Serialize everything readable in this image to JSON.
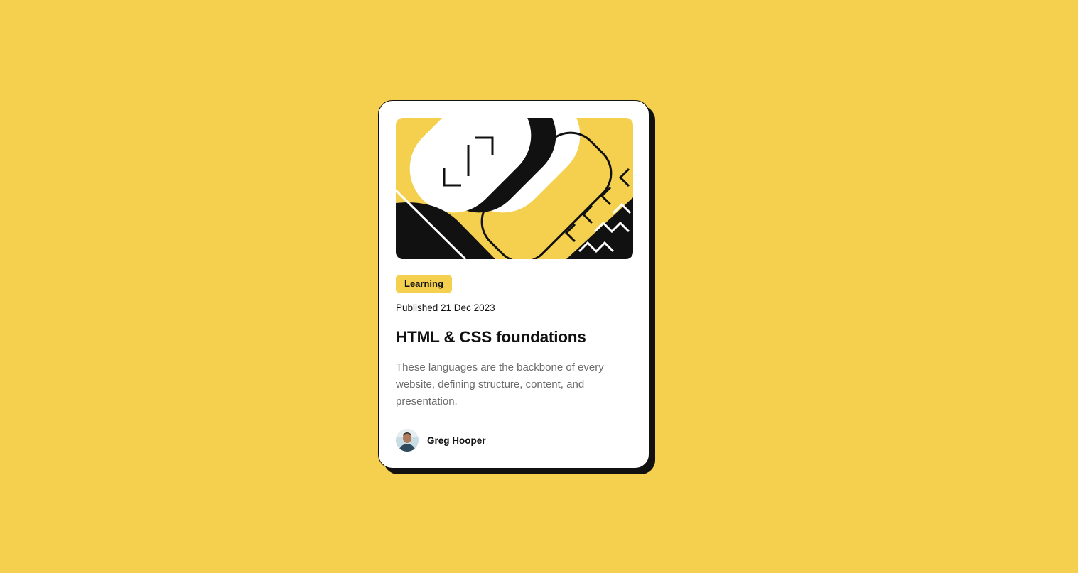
{
  "card": {
    "tag": "Learning",
    "published": "Published 21 Dec 2023",
    "title": "HTML & CSS foundations",
    "description": "These languages are the backbone of every website, defining structure, content, and presentation.",
    "author": {
      "name": "Greg Hooper",
      "avatar_icon": "avatar-photo"
    },
    "hero_image": "illustration-article"
  },
  "colors": {
    "background": "#f4d04e",
    "card": "#ffffff",
    "ink": "#111111",
    "muted_text": "#6b6b6b"
  }
}
